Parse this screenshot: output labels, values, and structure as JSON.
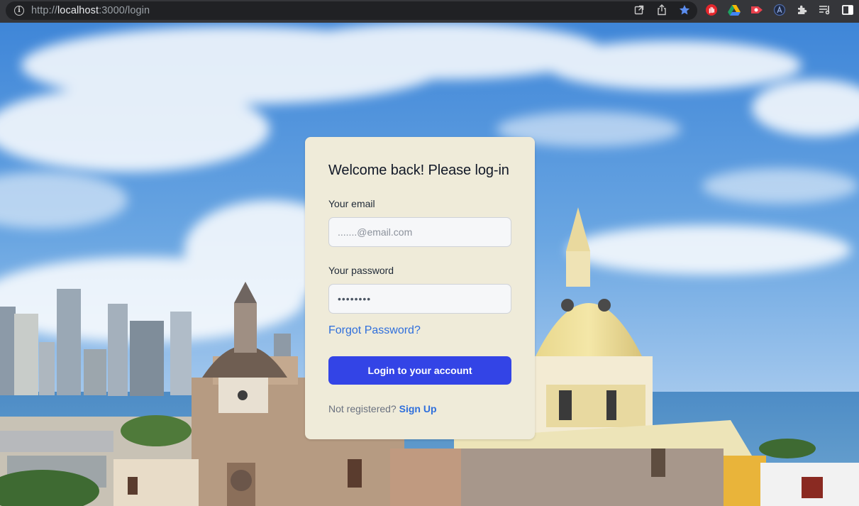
{
  "browser": {
    "url_scheme": "http://",
    "url_host": "localhost",
    "url_path": ":3000/login",
    "icons": [
      "info-icon",
      "open-external-icon",
      "share-icon",
      "bookmark-star-icon",
      "extension-hand-icon",
      "google-drive-icon",
      "extension-record-icon",
      "extension-a-icon",
      "extensions-puzzle-icon",
      "reading-list-icon",
      "side-panel-icon"
    ],
    "star_color": "#5b8def"
  },
  "login": {
    "title": "Welcome back! Please log-in",
    "email_label": "Your email",
    "email_placeholder": ".......@email.com",
    "email_value": "",
    "password_label": "Your password",
    "password_value": "••••••••",
    "forgot_link": "Forgot Password?",
    "submit_label": "Login to your account",
    "signup_prompt": "Not registered?",
    "signup_link": "Sign Up"
  },
  "colors": {
    "card_bg": "#efebd9",
    "primary_button": "#3344e6",
    "link": "#2f6fdc"
  }
}
